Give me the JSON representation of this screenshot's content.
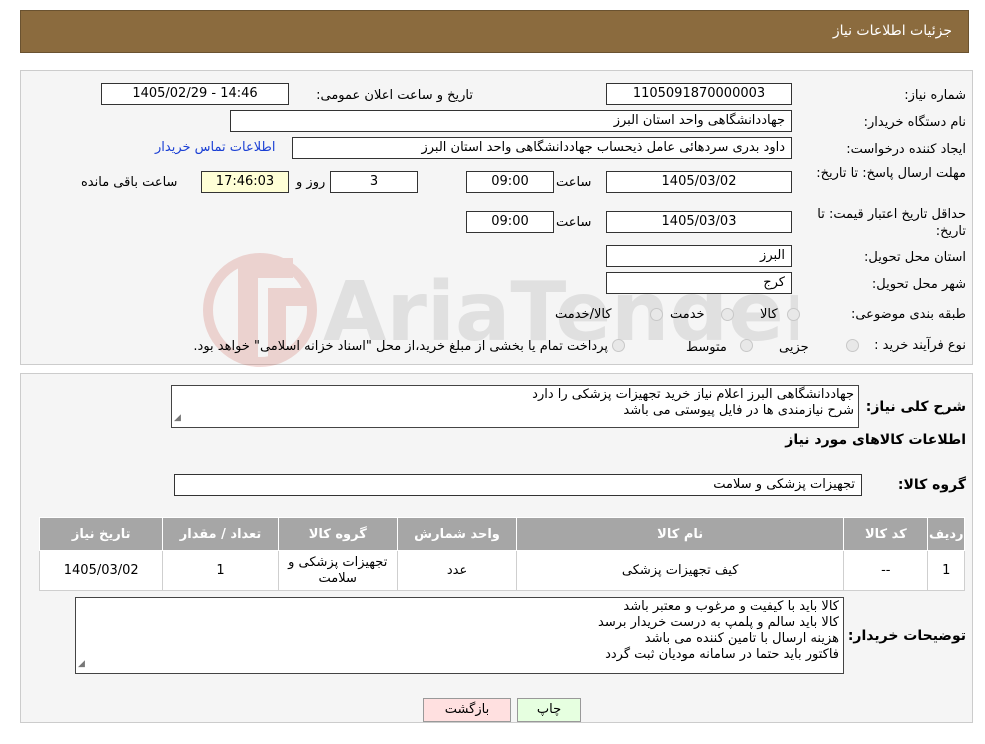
{
  "header": {
    "title": "جزئیات اطلاعات نیاز"
  },
  "details": {
    "need_number_label": "شماره نیاز:",
    "need_number": "1105091870000003",
    "announce_label": "تاریخ و ساعت اعلان عمومی:",
    "announce_value": "1405/02/29 - 14:46",
    "buyer_org_label": "نام دستگاه خریدار:",
    "buyer_org": "جهاددانشگاهی واحد استان البرز",
    "requester_label": "ایجاد کننده درخواست:",
    "requester": "داود بدری سردهائی عامل ذیحساب جهاددانشگاهی واحد استان البرز",
    "contact_link": "اطلاعات تماس خریدار",
    "deadline_label": "مهلت ارسال پاسخ: تا تاریخ:",
    "deadline_date": "1405/03/02",
    "time_label": "ساعت",
    "deadline_time": "09:00",
    "days": "3",
    "days_label": "روز و",
    "remaining_time": "17:46:03",
    "remaining_label": "ساعت باقی مانده",
    "validity_label": "حداقل تاریخ اعتبار قیمت: تا تاریخ:",
    "validity_date": "1405/03/03",
    "validity_time": "09:00",
    "province_label": "استان محل تحویل:",
    "province": "البرز",
    "city_label": "شهر محل تحویل:",
    "city": "کرج",
    "category_label": "طبقه بندی موضوعی:",
    "category_options": [
      "کالا",
      "خدمت",
      "کالا/خدمت"
    ],
    "process_label": "نوع فرآیند خرید :",
    "process_options": [
      "جزیی",
      "متوسط"
    ],
    "process_note": "پرداخت تمام یا بخشی از مبلغ خرید،از محل \"اسناد خزانه اسلامی\" خواهد بود."
  },
  "summary": {
    "label": "شرح کلی نیاز:",
    "line1": "جهاددانشگاهی البرز اعلام نیاز خرید تجهیزات پزشکی را دارد",
    "line2": "شرح نیازمندی ها در فایل پیوستی می باشد"
  },
  "goods_title": "اطلاعات کالاهای مورد نیاز",
  "goods_group_label": "گروه کالا:",
  "goods_group": "تجهیزات پزشکی و سلامت",
  "table": {
    "headers": [
      "ردیف",
      "کد کالا",
      "نام کالا",
      "واحد شمارش",
      "گروه کالا",
      "تعداد / مقدار",
      "تاریخ نیاز"
    ],
    "row": [
      "1",
      "--",
      "کیف تجهیزات پزشکی",
      "عدد",
      "تجهیزات پزشکی و سلامت",
      "1",
      "1405/03/02"
    ]
  },
  "buyer_notes": {
    "label": "توضیحات خریدار:",
    "lines": [
      "کالا باید با کیفیت و مرغوب و معتبر باشد",
      "کالا باید سالم و پلمپ به درست خریدار برسد",
      "هزینه ارسال با تامین کننده می باشد",
      "فاکتور باید حتما در سامانه مودیان ثبت گردد"
    ]
  },
  "buttons": {
    "back": "بازگشت",
    "print": "چاپ"
  },
  "watermark_text": "AriaTender.neT",
  "colors": {
    "header_bg": "#8B6B3E",
    "link": "#1a3fd4",
    "table_header": "#a6a6a6"
  }
}
